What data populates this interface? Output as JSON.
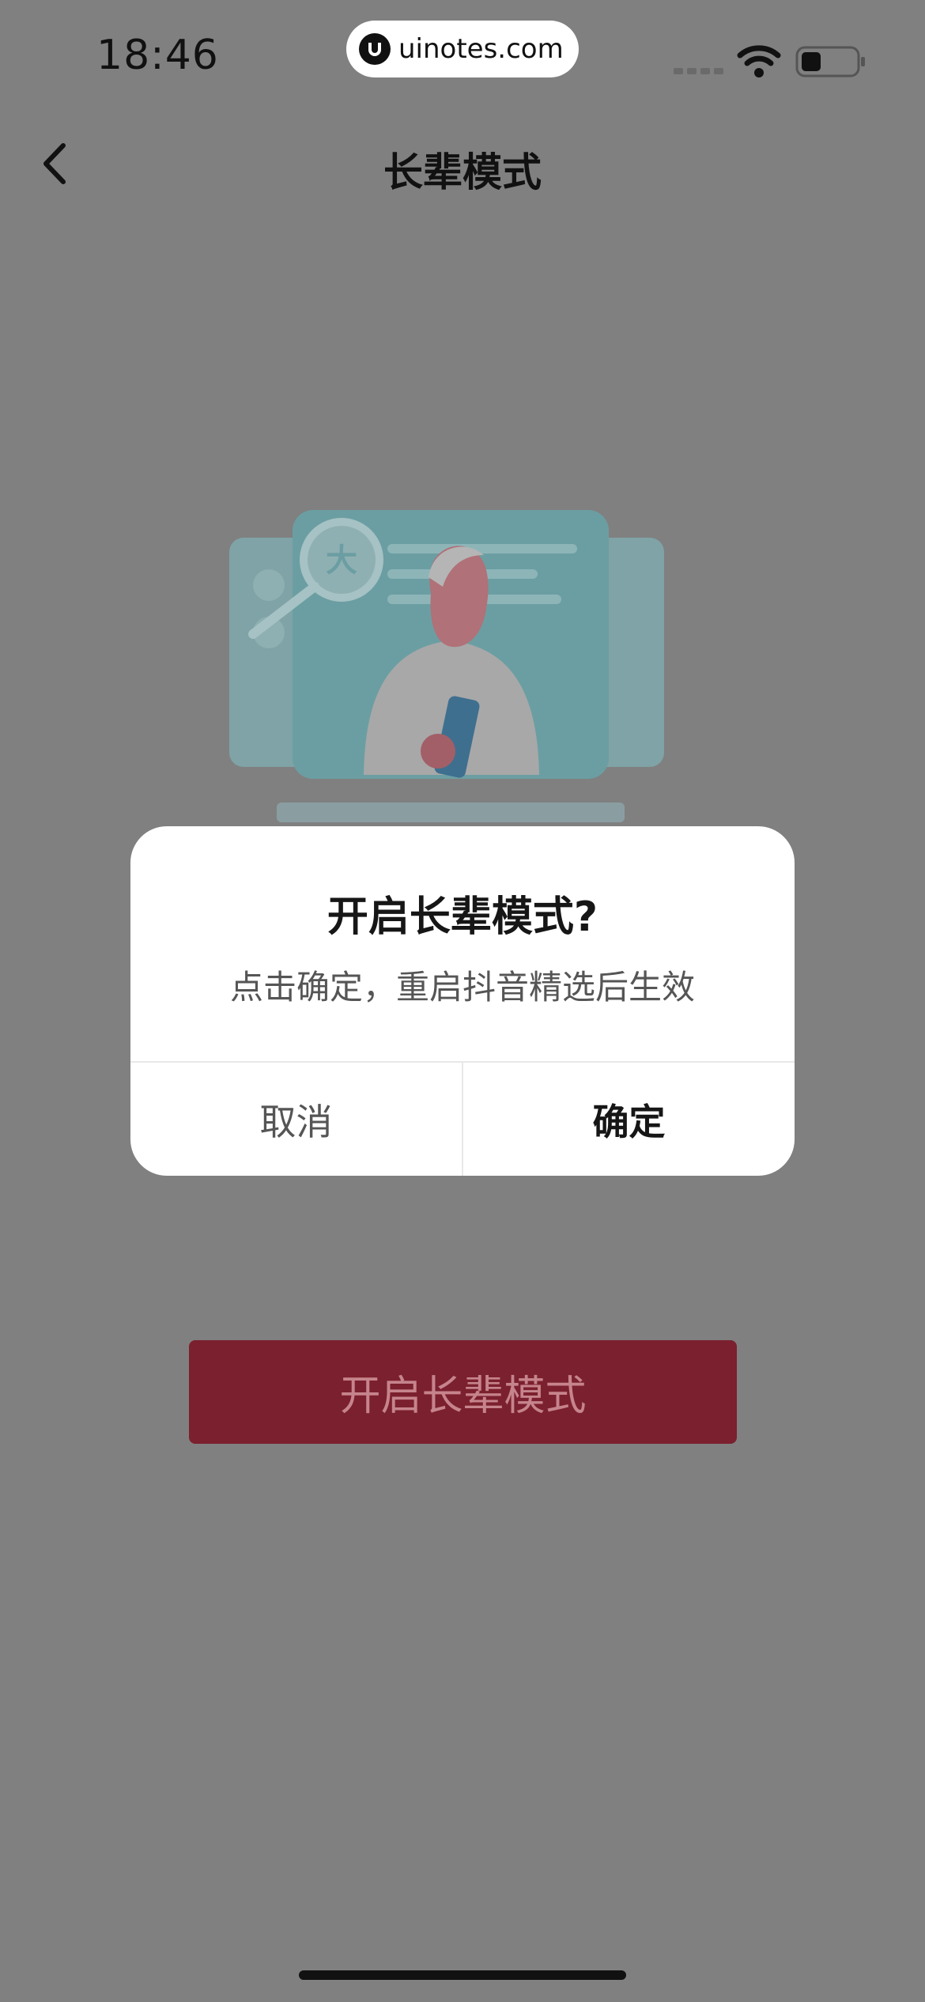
{
  "status_bar": {
    "time": "18:46",
    "site_label": "uinotes.com"
  },
  "nav": {
    "title": "长辈模式"
  },
  "illustration": {
    "badge_char": "大"
  },
  "primary_button": {
    "label": "开启长辈模式"
  },
  "dialog": {
    "title": "开启长辈模式?",
    "message": "点击确定，重启抖音精选后生效",
    "cancel_label": "取消",
    "confirm_label": "确定"
  },
  "colors": {
    "overlay_bg": "#808080",
    "primary_button_bg": "#7b202e",
    "primary_button_text": "#c6848c",
    "dialog_bg": "#ffffff"
  }
}
